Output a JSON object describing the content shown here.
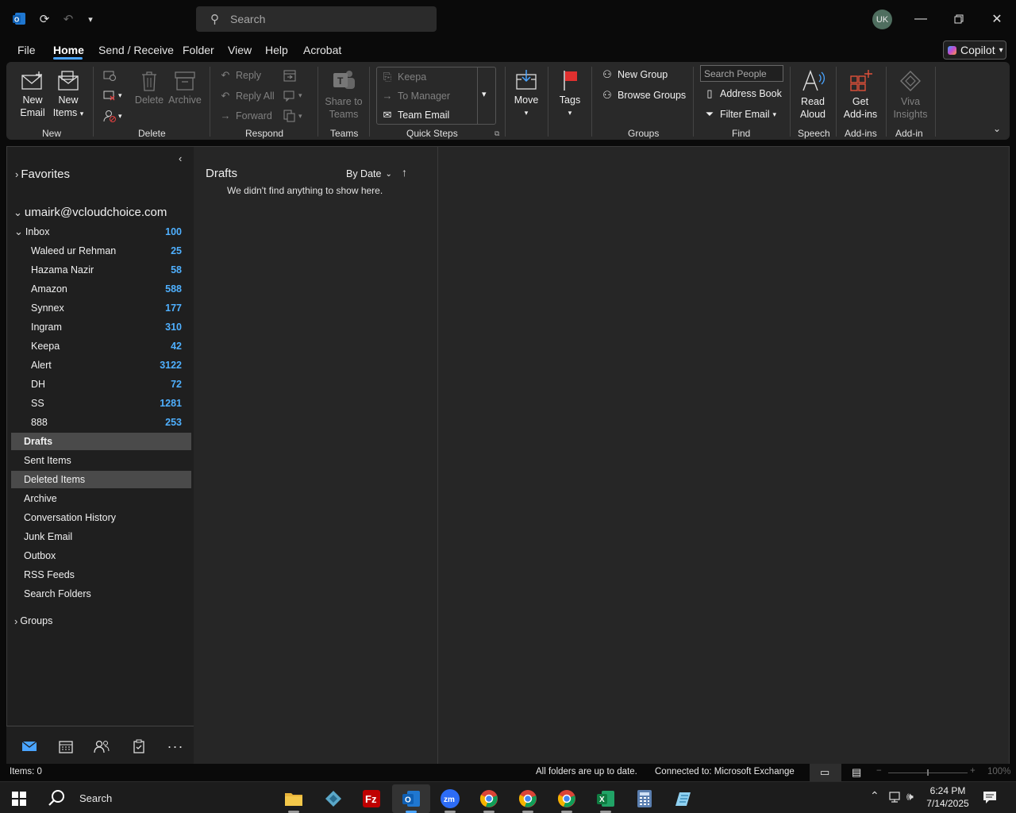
{
  "search": {
    "placeholder": "Search"
  },
  "user": {
    "initials": "UK"
  },
  "menu": [
    "File",
    "Home",
    "Send / Receive",
    "Folder",
    "View",
    "Help",
    "Acrobat"
  ],
  "copilot": {
    "label": "Copilot"
  },
  "ribbon": {
    "new_email": [
      "New",
      "Email"
    ],
    "new_items": [
      "New",
      "Items"
    ],
    "delete": "Delete",
    "archive": "Archive",
    "reply": "Reply",
    "reply_all": "Reply All",
    "forward": "Forward",
    "share_teams": [
      "Share to",
      "Teams"
    ],
    "quick_steps": [
      "Keepa",
      "To Manager",
      "Team Email"
    ],
    "move": "Move",
    "tags": "Tags",
    "new_group": "New Group",
    "browse_groups": "Browse Groups",
    "search_people": "Search People",
    "address_book": "Address Book",
    "filter_email": "Filter Email",
    "read_aloud": [
      "Read",
      "Aloud"
    ],
    "get_addins": [
      "Get",
      "Add-ins"
    ],
    "viva": [
      "Viva",
      "Insights"
    ],
    "groups": {
      "new": "New",
      "delete": "Delete",
      "respond": "Respond",
      "teams": "Teams",
      "quick_steps": "Quick Steps",
      "groups": "Groups",
      "find": "Find",
      "speech": "Speech",
      "addins": "Add-ins",
      "addin": "Add-in"
    }
  },
  "folders": {
    "favorites": "Favorites",
    "account": "umairk@vcloudchoice.com",
    "inbox": {
      "label": "Inbox",
      "count": "100"
    },
    "inbox_children": [
      {
        "label": "Waleed ur Rehman",
        "count": "25"
      },
      {
        "label": "Hazama Nazir",
        "count": "58"
      },
      {
        "label": "Amazon",
        "count": "588"
      },
      {
        "label": "Synnex",
        "count": "177"
      },
      {
        "label": "Ingram",
        "count": "310"
      },
      {
        "label": "Keepa",
        "count": "42"
      },
      {
        "label": "Alert",
        "count": "3122"
      },
      {
        "label": "DH",
        "count": "72"
      },
      {
        "label": "SS",
        "count": "1281"
      },
      {
        "label": "888",
        "count": "253"
      }
    ],
    "others": [
      "Drafts",
      "Sent Items",
      "Deleted Items",
      "Archive",
      "Conversation History",
      "Junk Email",
      "Outbox",
      "RSS Feeds",
      "Search Folders"
    ],
    "groups": "Groups"
  },
  "message_list": {
    "title": "Drafts",
    "sort": "By Date",
    "empty": "We didn't find anything to show here."
  },
  "status": {
    "items": "Items: 0",
    "sync": "All folders are up to date.",
    "connection": "Connected to: Microsoft Exchange",
    "zoom": "100%"
  },
  "taskbar": {
    "search": "Search",
    "time": "6:24 PM",
    "date": "7/14/2025"
  }
}
